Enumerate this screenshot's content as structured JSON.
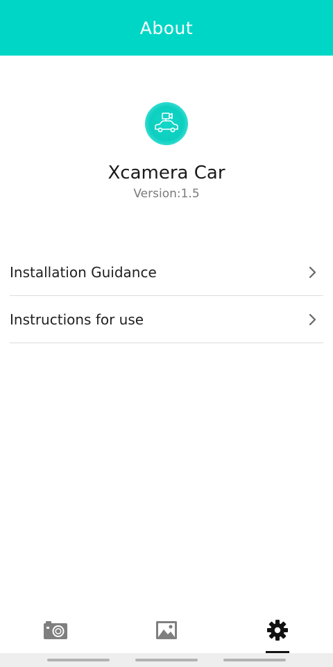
{
  "header": {
    "title": "About"
  },
  "app": {
    "logo_icon": "car-camera-icon",
    "name": "Xcamera Car",
    "version": "Version:1.5"
  },
  "menu": {
    "items": [
      {
        "label": "Installation Guidance",
        "icon": "chevron-right-icon"
      },
      {
        "label": "Instructions for use",
        "icon": "chevron-right-icon"
      }
    ]
  },
  "tabbar": {
    "tabs": [
      {
        "icon": "camera-icon",
        "active": false
      },
      {
        "icon": "gallery-icon",
        "active": false
      },
      {
        "icon": "gear-icon",
        "active": true
      }
    ]
  },
  "colors": {
    "accent": "#00d6c6",
    "tab_inactive": "#7f7f7f",
    "tab_active": "#111111"
  }
}
